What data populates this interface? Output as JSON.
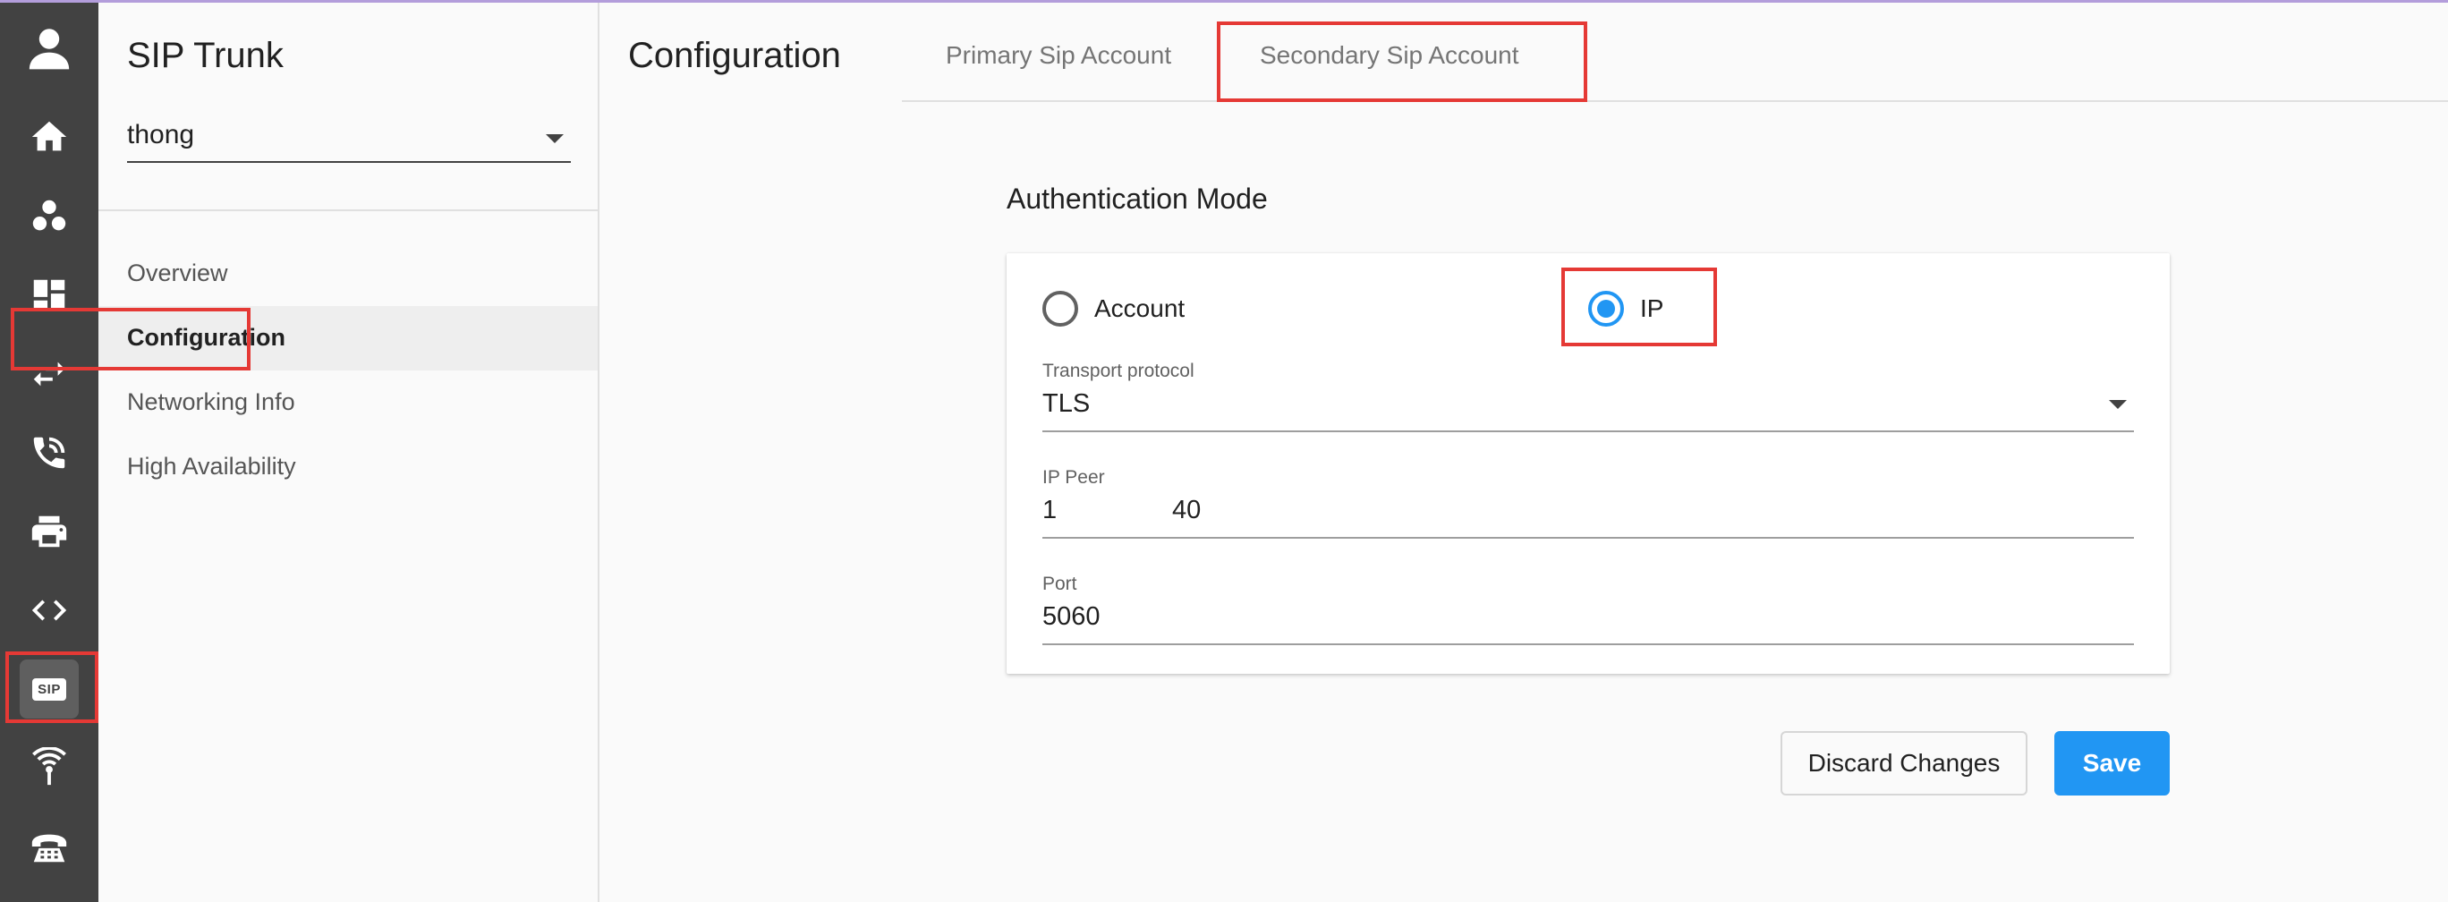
{
  "rail": {
    "items": [
      {
        "name": "user-avatar-icon"
      },
      {
        "name": "home-icon"
      },
      {
        "name": "groups-icon"
      },
      {
        "name": "dashboard-icon"
      },
      {
        "name": "transfer-arrows-icon"
      },
      {
        "name": "phone-forward-icon"
      },
      {
        "name": "printer-icon"
      },
      {
        "name": "code-icon"
      },
      {
        "name": "sip-icon",
        "label": "SIP",
        "active": true
      },
      {
        "name": "antenna-icon"
      },
      {
        "name": "desk-phone-icon"
      }
    ]
  },
  "subnav": {
    "title": "SIP Trunk",
    "trunk_select": {
      "value": "thong"
    },
    "items": [
      {
        "label": "Overview"
      },
      {
        "label": "Configuration",
        "active": true
      },
      {
        "label": "Networking Info"
      },
      {
        "label": "High Availability"
      }
    ]
  },
  "main": {
    "title": "Configuration",
    "tabs": [
      {
        "label": "Primary Sip Account"
      },
      {
        "label": "Secondary Sip Account",
        "active": true
      }
    ],
    "auth_section": {
      "title": "Authentication Mode",
      "options": [
        {
          "label": "Account",
          "selected": false
        },
        {
          "label": "IP",
          "selected": true
        }
      ],
      "transport": {
        "label": "Transport protocol",
        "value": "TLS"
      },
      "ip_peer": {
        "label": "IP Peer",
        "value": "1                40"
      },
      "port": {
        "label": "Port",
        "value": "5060"
      }
    },
    "actions": {
      "discard_label": "Discard Changes",
      "save_label": "Save"
    }
  },
  "colors": {
    "rail_bg": "#424242",
    "accent": "#2196f3",
    "highlight": "#e53935"
  }
}
